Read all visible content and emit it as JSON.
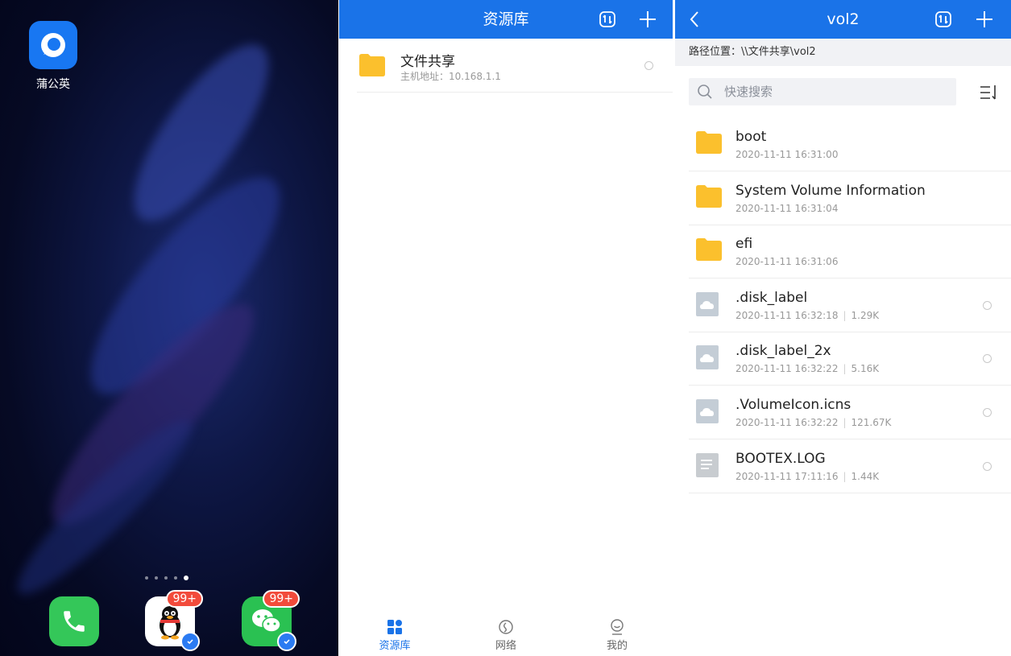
{
  "home": {
    "app_label": "蒲公英",
    "qq_badge": "99+",
    "wechat_badge": "99+",
    "page_count": 5,
    "active_page": 5
  },
  "library": {
    "title": "资源库",
    "items": [
      {
        "name": "文件共享",
        "host": "主机地址：10.168.1.1"
      }
    ],
    "nav": [
      {
        "label": "资源库",
        "active": true
      },
      {
        "label": "网络",
        "active": false
      },
      {
        "label": "我的",
        "active": false
      }
    ],
    "colors": {
      "accent": "#1a73e8",
      "folder": "#fbc02d"
    }
  },
  "vol": {
    "title": "vol2",
    "path": "路径位置：\\\\文件共享\\vol2",
    "search_placeholder": "快速搜索",
    "files": [
      {
        "name": "boot",
        "date": "2020-11-11 16:31:00",
        "size": "",
        "type": "folder"
      },
      {
        "name": "System Volume Information",
        "date": "2020-11-11 16:31:04",
        "size": "",
        "type": "folder"
      },
      {
        "name": "efi",
        "date": "2020-11-11 16:31:06",
        "size": "",
        "type": "folder"
      },
      {
        "name": ".disk_label",
        "date": "2020-11-11 16:32:18",
        "size": "1.29K",
        "type": "cloud-file"
      },
      {
        "name": ".disk_label_2x",
        "date": "2020-11-11 16:32:22",
        "size": "5.16K",
        "type": "cloud-file"
      },
      {
        "name": ".VolumeIcon.icns",
        "date": "2020-11-11 16:32:22",
        "size": "121.67K",
        "type": "cloud-file"
      },
      {
        "name": "BOOTEX.LOG",
        "date": "2020-11-11 17:11:16",
        "size": "1.44K",
        "type": "text-file"
      }
    ]
  }
}
